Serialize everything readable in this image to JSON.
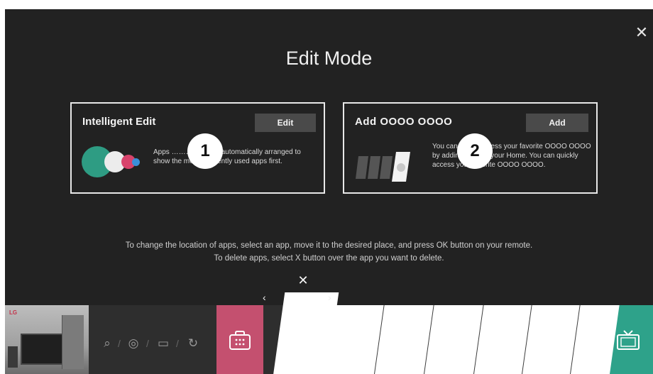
{
  "header": {
    "title": "Edit Mode",
    "close_glyph": "✕"
  },
  "cards": [
    {
      "title": "Intelligent Edit",
      "button_label": "Edit",
      "badge": "1",
      "description": "Apps …………… are automatically arranged to show the most frequently used apps first."
    },
    {
      "title": "Add  OOOO  OOOO",
      "button_label": "Add",
      "badge": "2",
      "description": "You can easily access your favorite OOOO OOOO by adding them to your Home. You can quickly access your favorite OOOO OOOO."
    }
  ],
  "instructions": {
    "line1": "To change the location of apps, select an app, move it to the desired place, and press OK button on your remote.",
    "line2": "To delete apps, select X button over the app you want to delete."
  },
  "bottom_bar": {
    "preview_logo": "LG",
    "nav_icons": [
      "search-icon",
      "home-camera-icon",
      "input-monitor-icon",
      "recent-history-icon"
    ],
    "nav_glyphs": [
      "⌕",
      "◎",
      "▭",
      "↻"
    ],
    "separator": "/",
    "tile_nav": {
      "left_arrow": "‹",
      "right_arrow": "›",
      "delete_glyph": "✕"
    },
    "colors": {
      "store_tile": "#c4506f",
      "tv_tile": "#2ea28a",
      "card_border": "#e8e8e8",
      "background": "#222222"
    }
  }
}
